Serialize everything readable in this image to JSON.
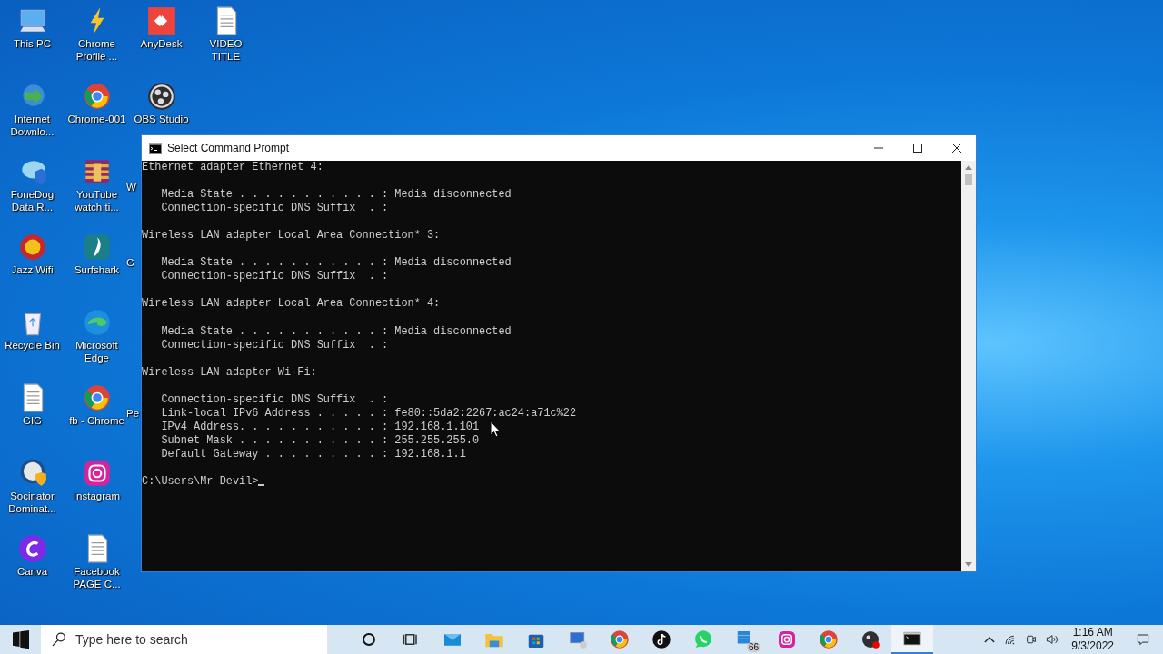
{
  "desktop": {
    "rows": [
      [
        {
          "kind": "pc",
          "label": "This PC"
        },
        {
          "kind": "bolt",
          "label": "Chrome Profile ..."
        },
        {
          "kind": "anydesk",
          "label": "AnyDesk"
        },
        {
          "kind": "doc",
          "label": "VIDEO TITLE"
        }
      ],
      [
        {
          "kind": "idm",
          "label": "Internet Downlo..."
        },
        {
          "kind": "chrome",
          "label": "Chrome-001"
        },
        {
          "kind": "obs",
          "label": "OBS Studio"
        }
      ],
      [
        {
          "kind": "fonedog",
          "label": "FoneDog Data R..."
        },
        {
          "kind": "winrar",
          "label": "YouTube watch ti..."
        },
        {
          "kind": "partial",
          "label": "W"
        }
      ],
      [
        {
          "kind": "jazz",
          "label": "Jazz Wifi"
        },
        {
          "kind": "surfshark",
          "label": "Surfshark"
        },
        {
          "kind": "partial",
          "label": "G"
        }
      ],
      [
        {
          "kind": "recycle",
          "label": "Recycle Bin"
        },
        {
          "kind": "edge",
          "label": "Microsoft Edge"
        }
      ],
      [
        {
          "kind": "doc",
          "label": "GIG"
        },
        {
          "kind": "chrome",
          "label": "fb - Chrome"
        },
        {
          "kind": "partial",
          "label": "Pe"
        }
      ],
      [
        {
          "kind": "socinator",
          "label": "Socinator Dominat..."
        },
        {
          "kind": "instagram",
          "label": "Instagram"
        }
      ],
      [
        {
          "kind": "canva",
          "label": "Canva"
        },
        {
          "kind": "doc",
          "label": "Facebook PAGE C..."
        }
      ]
    ]
  },
  "window": {
    "title": "Select Command Prompt",
    "sections": [
      {
        "heading": "Ethernet adapter Ethernet 4:",
        "lines": [
          "   Media State . . . . . . . . . . . : Media disconnected",
          "   Connection-specific DNS Suffix  . :"
        ]
      },
      {
        "heading": "Wireless LAN adapter Local Area Connection* 3:",
        "lines": [
          "   Media State . . . . . . . . . . . : Media disconnected",
          "   Connection-specific DNS Suffix  . :"
        ]
      },
      {
        "heading": "Wireless LAN adapter Local Area Connection* 4:",
        "lines": [
          "   Media State . . . . . . . . . . . : Media disconnected",
          "   Connection-specific DNS Suffix  . :"
        ]
      },
      {
        "heading": "Wireless LAN adapter Wi-Fi:",
        "lines": [
          "   Connection-specific DNS Suffix  . :",
          "   Link-local IPv6 Address . . . . . : fe80::5da2:2267:ac24:a71c%22",
          "   IPv4 Address. . . . . . . . . . . : 192.168.1.101",
          "   Subnet Mask . . . . . . . . . . . : 255.255.255.0",
          "   Default Gateway . . . . . . . . . : 192.168.1.1"
        ]
      }
    ],
    "prompt": "C:\\Users\\Mr Devil>"
  },
  "taskbar": {
    "search": {
      "placeholder": "Type here to search"
    },
    "apps": [
      {
        "kind": "cortana",
        "selected": false
      },
      {
        "kind": "taskview",
        "selected": false
      },
      {
        "kind": "mail",
        "selected": false
      },
      {
        "kind": "explorer",
        "selected": false
      },
      {
        "kind": "store",
        "selected": false
      },
      {
        "kind": "remote",
        "selected": false
      },
      {
        "kind": "chrome",
        "selected": false
      },
      {
        "kind": "tiktok",
        "selected": false
      },
      {
        "kind": "whatsapp",
        "selected": false
      },
      {
        "kind": "app",
        "selected": false,
        "badge": "66"
      },
      {
        "kind": "instagram",
        "selected": false
      },
      {
        "kind": "chrome",
        "selected": false
      },
      {
        "kind": "obs",
        "selected": false
      },
      {
        "kind": "cmd",
        "selected": true
      }
    ],
    "time": "1:16 AM",
    "date": "9/3/2022"
  }
}
